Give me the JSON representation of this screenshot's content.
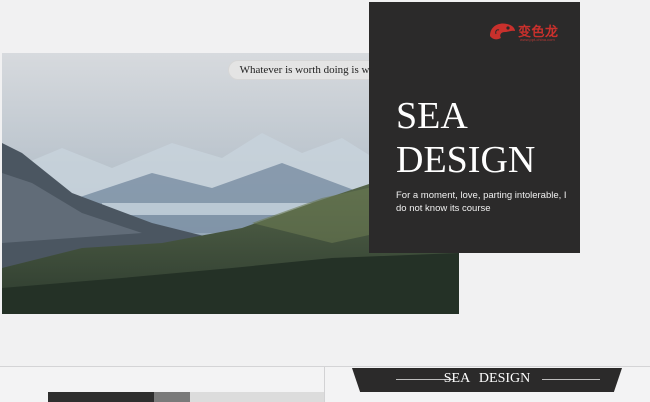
{
  "slide": {
    "quote": "Whatever is worth doing  is worth doing  well.",
    "title_line1": "SEA",
    "title_line2": "DESIGN",
    "subtitle": "For a moment, love, parting intolerable, I do not know its course",
    "brand": {
      "name": "变色龙",
      "url": "www.ppt-china.com",
      "color": "#c9302c",
      "icon": "chameleon-logo-icon"
    },
    "card_color": "#2b2a2a"
  },
  "next_slide": {
    "banner_text": "SEA  DESIGN"
  }
}
